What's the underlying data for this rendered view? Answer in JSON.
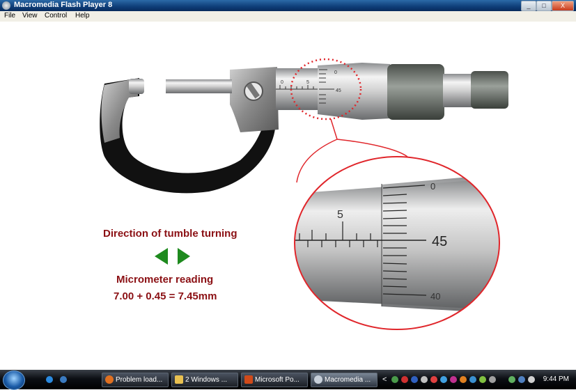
{
  "window": {
    "title": "Macromedia Flash Player 8",
    "min": "_",
    "max": "□",
    "close": "X"
  },
  "menu": [
    "File",
    "View",
    "Control",
    "Help"
  ],
  "stage": {
    "direction_label": "Direction of tumble turning",
    "reading_label": "Micrometer reading",
    "reading_value": "7.00 + 0.45 = 7.45mm",
    "small_scale": {
      "sleeve_numbers": [
        "0",
        "5"
      ],
      "thimble_numbers": [
        "0",
        "45"
      ]
    },
    "zoom_scale": {
      "sleeve_number": "5",
      "thimble_numbers": [
        "0",
        "45",
        "40"
      ]
    },
    "colors": {
      "label_red": "#8b1014",
      "arrow_green": "#1e8a1e",
      "callout_red": "#e0262b"
    }
  },
  "taskbar": {
    "items": [
      {
        "label": "Problem load...",
        "icon": "firefox-icon"
      },
      {
        "label": "2 Windows ...",
        "icon": "folder-icon"
      },
      {
        "label": "Microsoft Po...",
        "icon": "powerpoint-icon"
      },
      {
        "label": "Macromedia ...",
        "icon": "flash-icon"
      }
    ],
    "clock": "9:44 PM",
    "expand": "<"
  }
}
